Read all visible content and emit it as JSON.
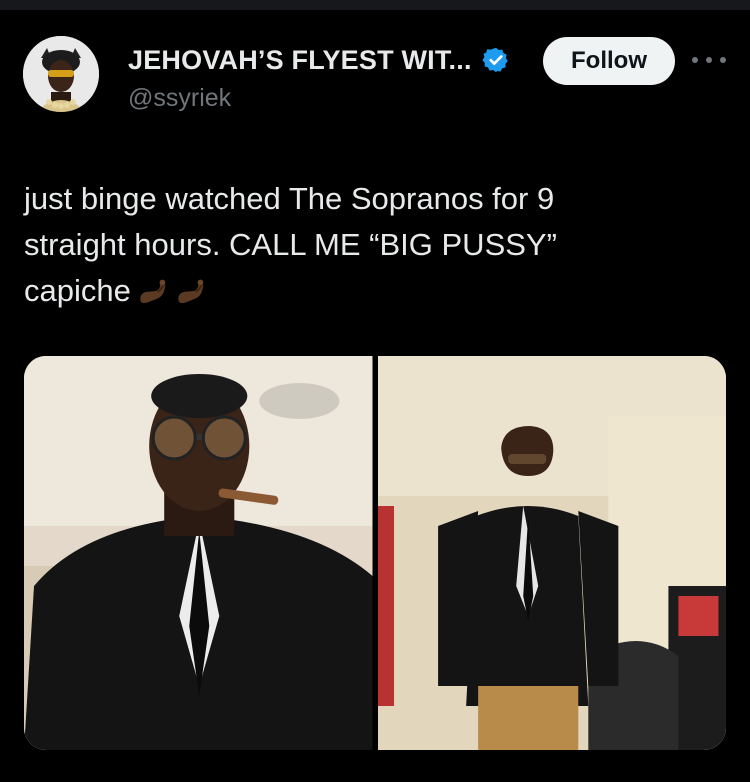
{
  "window": {
    "top_bar_color": "#16181c"
  },
  "author": {
    "display_name": "JEHOVAH’S FLYEST WIT...",
    "handle": "@ssyriek",
    "verified": true,
    "verified_color": "#1d9bf0",
    "avatar_icon": "profile-photo"
  },
  "actions": {
    "follow_label": "Follow",
    "more_icon": "more-options-icon"
  },
  "tweet": {
    "text": "just binge watched The Sopranos for 9\nstraight hours. CALL ME “BIG PUSSY”\ncapiche",
    "emoji_name": "pinched-fingers-dark-skin-tone",
    "emoji_count": 2
  },
  "media": {
    "count": 2,
    "photos": [
      {
        "name": "photo-1",
        "alt": "selfie in black suit with cigar and tinted glasses"
      },
      {
        "name": "photo-2",
        "alt": "full-body photo in oversized-shoulder suit jacket"
      }
    ]
  },
  "colors": {
    "background": "#000000",
    "text_primary": "#e7e9ea",
    "text_secondary": "#71767b",
    "follow_bg": "#eff3f4",
    "follow_text": "#0f1419"
  }
}
